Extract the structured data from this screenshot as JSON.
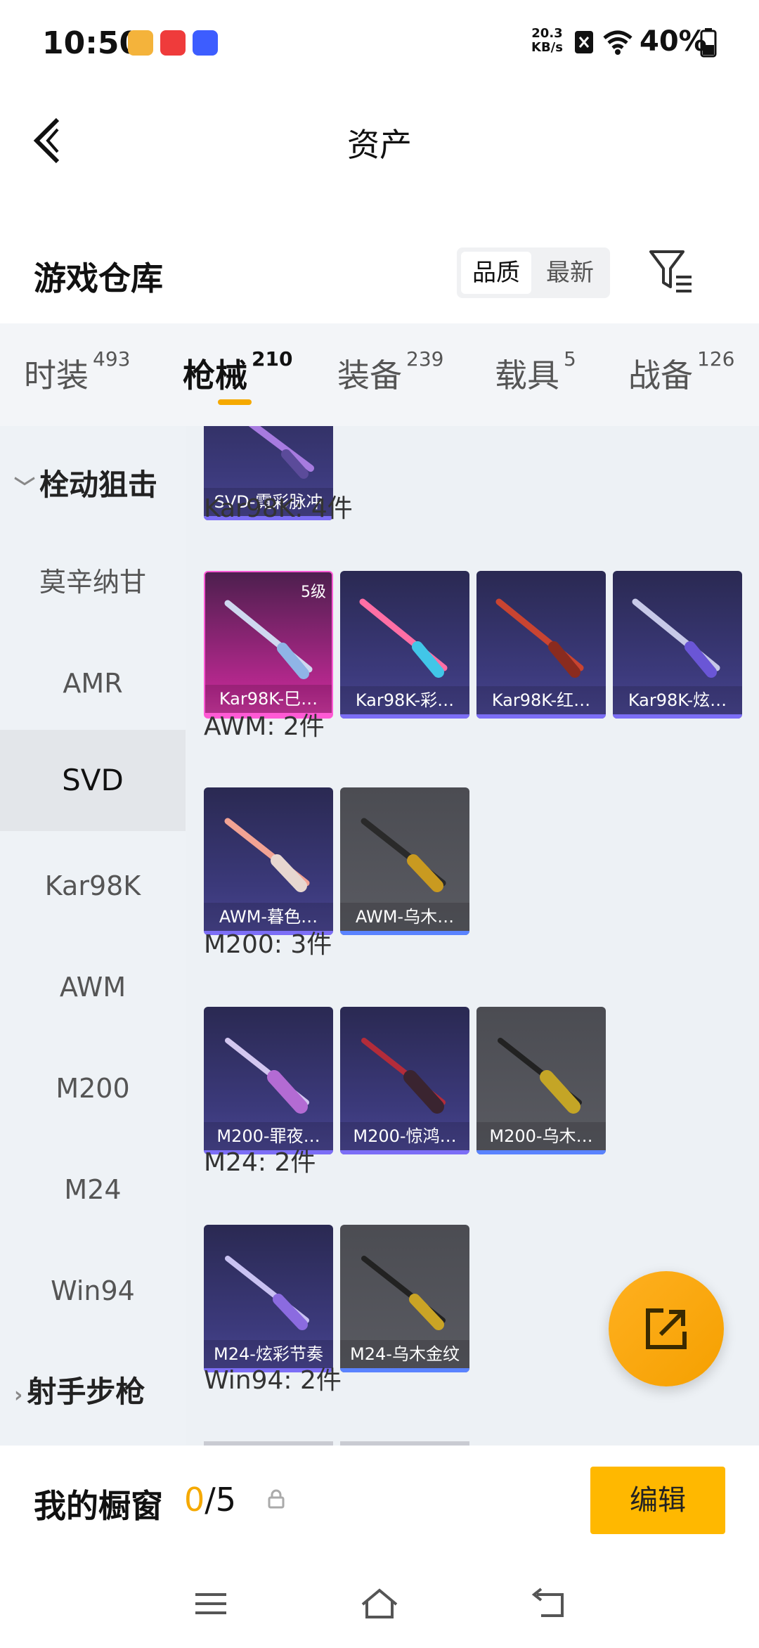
{
  "status_bar": {
    "time": "10:50",
    "app_icons": [
      {
        "name": "app-icon-1",
        "color": "#f4b33b"
      },
      {
        "name": "huawei-app-icon",
        "color": "#ef3b3b"
      },
      {
        "name": "vivo-app-icon",
        "color": "#3d5dff"
      }
    ],
    "net_speed_value": "20.3",
    "net_speed_unit": "KB/s",
    "battery": "40%"
  },
  "header": {
    "title": "资产"
  },
  "warehouse": {
    "title": "游戏仓库",
    "sort": {
      "quality": "品质",
      "newest": "最新",
      "selected": "品质"
    }
  },
  "tabs": [
    {
      "label": "时装",
      "count": "493"
    },
    {
      "label": "枪械",
      "count": "210",
      "active": true
    },
    {
      "label": "装备",
      "count": "239"
    },
    {
      "label": "载具",
      "count": "5"
    },
    {
      "label": "战备",
      "count": "126"
    }
  ],
  "sidebar": {
    "group_open": "栓动狙击",
    "items": [
      "莫辛纳甘",
      "AMR",
      "SVD",
      "Kar98K",
      "AWM",
      "M200",
      "M24",
      "Win94"
    ],
    "active": "SVD",
    "group_closed": "射手步枪"
  },
  "content": {
    "top_card": {
      "name": "SVD-霓彩脉冲"
    },
    "sections": [
      {
        "label": "Kar98K: 4件",
        "cards": [
          {
            "name": "Kar98K-巳…",
            "level": "5级"
          },
          {
            "name": "Kar98K-彩…"
          },
          {
            "name": "Kar98K-红…"
          },
          {
            "name": "Kar98K-炫…"
          }
        ]
      },
      {
        "label": "AWM: 2件",
        "cards": [
          {
            "name": "AWM-暮色…"
          },
          {
            "name": "AWM-乌木…"
          }
        ]
      },
      {
        "label": "M200: 3件",
        "cards": [
          {
            "name": "M200-罪夜…"
          },
          {
            "name": "M200-惊鸿…"
          },
          {
            "name": "M200-乌木…"
          }
        ]
      },
      {
        "label": "M24: 2件",
        "cards": [
          {
            "name": "M24-炫彩节奏"
          },
          {
            "name": "M24-乌木金纹"
          }
        ]
      },
      {
        "label": "Win94: 2件",
        "cards": []
      }
    ]
  },
  "showcase": {
    "label": "我的橱窗",
    "current": "0",
    "total": "/5",
    "edit": "编辑"
  },
  "colors": {
    "accent": "#f5a900",
    "epic": "#3c3a7c",
    "legend": "#b8288f"
  }
}
